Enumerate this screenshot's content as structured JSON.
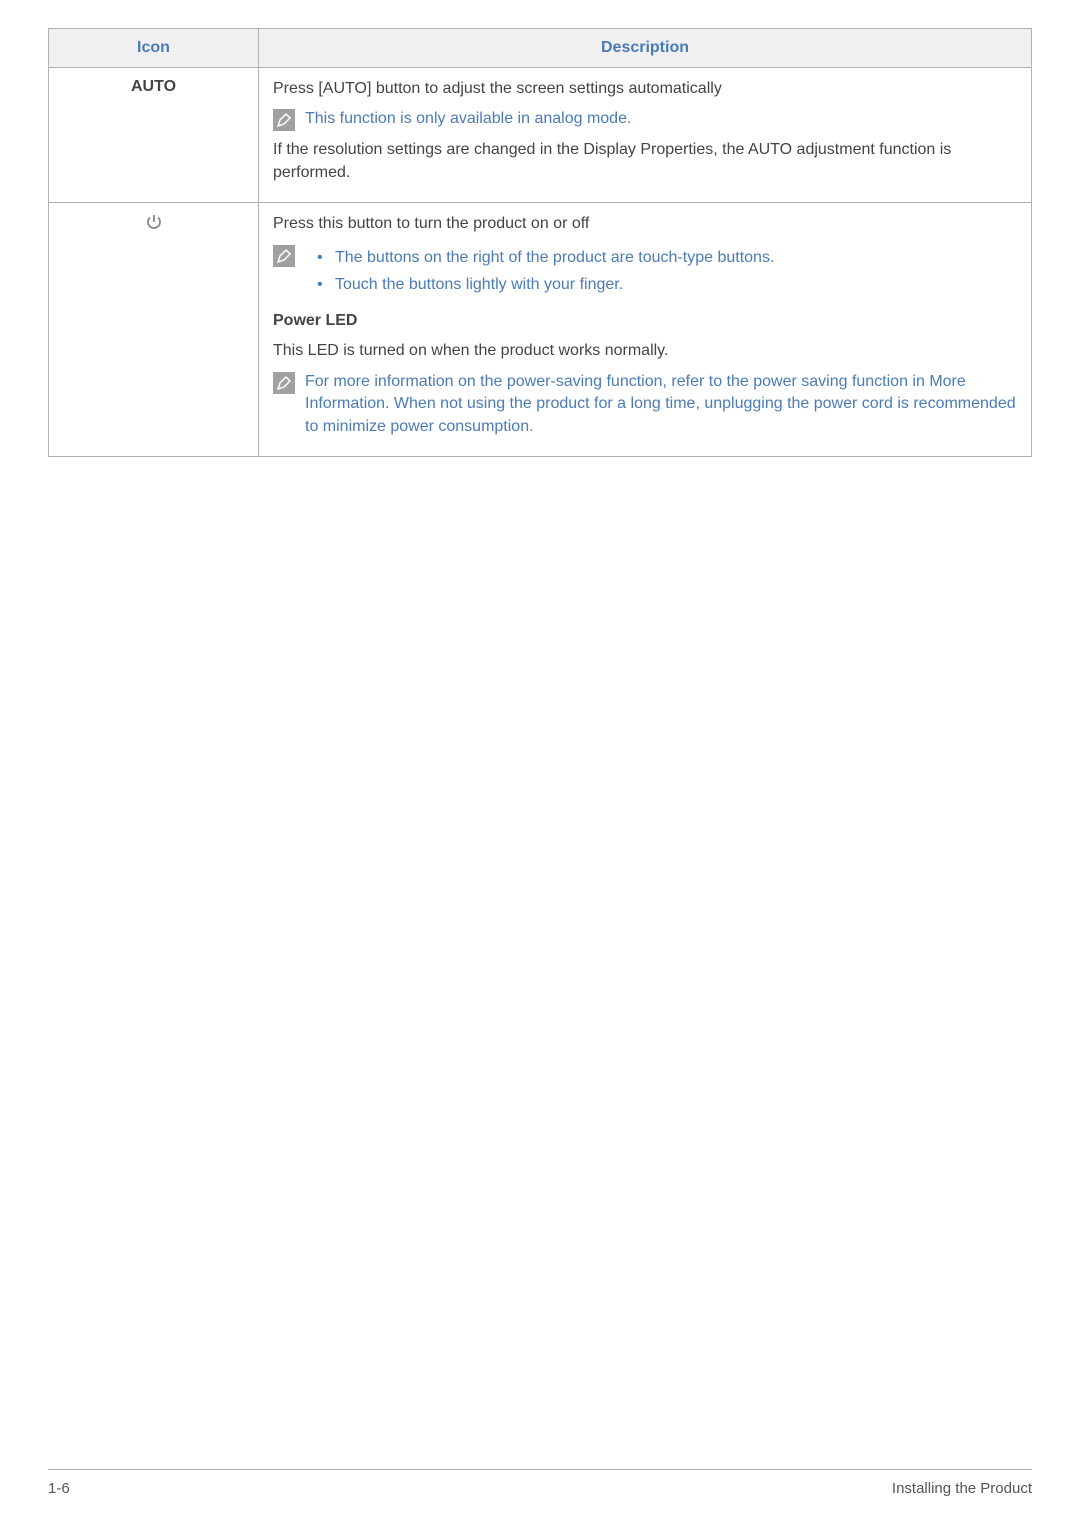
{
  "table": {
    "headers": {
      "icon": "Icon",
      "description": "Description"
    },
    "rows": {
      "auto": {
        "label": "AUTO",
        "desc_line1": "Press [AUTO] button to adjust the screen settings automatically",
        "note1": "This function is only available in analog mode.",
        "desc_line2": "If the resolution settings are changed in the Display Properties, the AUTO adjustment function is performed."
      },
      "power": {
        "desc_line1": "Press this button to turn the product on or off",
        "note_item1": "The buttons on the right of the product are touch-type buttons.",
        "note_item2": "Touch the buttons lightly with your finger.",
        "subheading": "Power LED",
        "desc_line2": "This LED is turned on when the product works normally.",
        "note2": "For more information on the power-saving function, refer to the power saving function in More Information. When not using the product for a long time, unplugging the power cord is recommended to minimize power consumption."
      }
    }
  },
  "footer": {
    "left": "1-6",
    "right": "Installing the Product"
  }
}
